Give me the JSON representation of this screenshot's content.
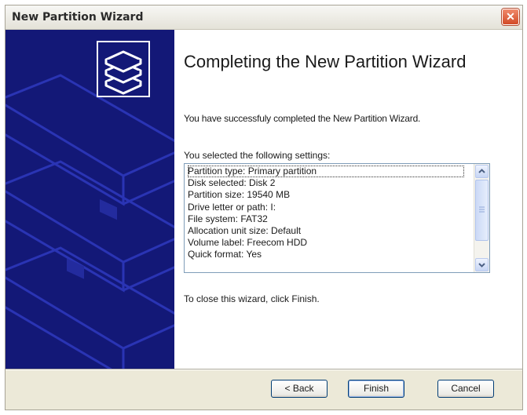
{
  "window": {
    "title": "New Partition Wizard",
    "close_glyph": "✕"
  },
  "content": {
    "heading": "Completing the New Partition Wizard",
    "success_message": "You have successfuly completed the New Partition Wizard.",
    "settings_label": "You selected the following settings:",
    "settings": [
      "Partition type: Primary partition",
      "Disk selected: Disk 2",
      "Partition size: 19540 MB",
      "Drive letter or path: I:",
      "File system: FAT32",
      "Allocation unit size: Default",
      "Volume label: Freecom HDD",
      "Quick format: Yes"
    ],
    "close_instruction": "To close this wizard, click Finish."
  },
  "buttons": {
    "back": "< Back",
    "finish": "Finish",
    "cancel": "Cancel"
  },
  "icons": {
    "banner": "disk-stack-icon"
  },
  "colors": {
    "banner": "#131877",
    "accent_border": "#003c74"
  }
}
